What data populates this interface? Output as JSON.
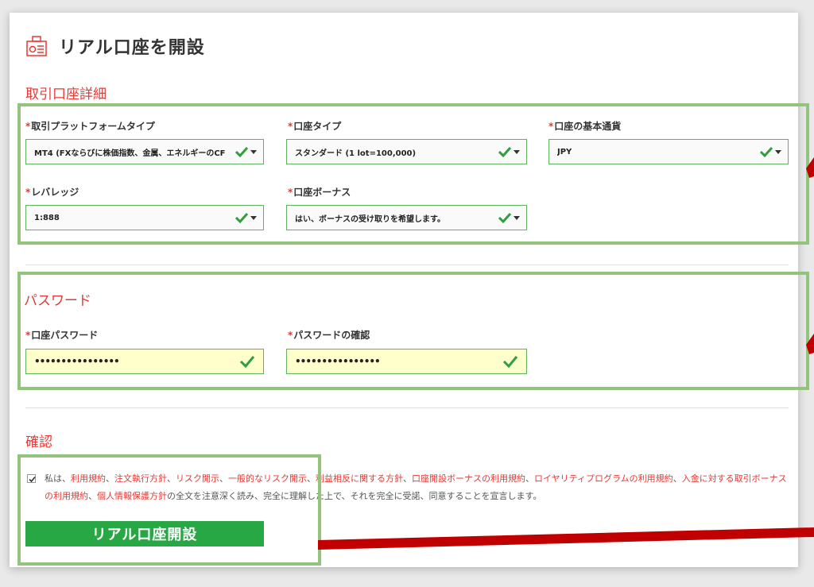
{
  "page": {
    "title": "リアル口座を開設"
  },
  "account_details": {
    "section_title": "取引口座詳細",
    "platform": {
      "required": "*",
      "label": "取引プラットフォームタイプ",
      "value": "MT4 (FXならびに株価指数、金属、エネルギーのCF"
    },
    "account_type": {
      "required": "*",
      "label": "口座タイプ",
      "value": "スタンダード (1 lot=100,000)"
    },
    "base_currency": {
      "required": "*",
      "label": "口座の基本通貨",
      "value": "JPY"
    },
    "leverage": {
      "required": "*",
      "label": "レバレッジ",
      "value": "1:888"
    },
    "bonus": {
      "required": "*",
      "label": "口座ボーナス",
      "value": "はい、ボーナスの受け取りを希望します。"
    }
  },
  "password": {
    "section_title": "パスワード",
    "account_password": {
      "required": "*",
      "label": "口座パスワード",
      "value": "••••••••••••••••"
    },
    "confirm_password": {
      "required": "*",
      "label": "パスワードの確認",
      "value": "••••••••••••••••"
    }
  },
  "confirmation": {
    "section_title": "確認",
    "t1": "私は、",
    "l1": "利用規約",
    "s1": "、",
    "l2": "注文執行方針",
    "s2": "、",
    "l3": "リスク開示",
    "s3": "、",
    "l4": "一般的なリスク開示",
    "s4": "、",
    "l5": "利益相反に関する方針",
    "s5": "、",
    "l6": "口座開設ボーナスの利用規約",
    "s6": "、",
    "l7": "ロイヤリティプログラムの利用規約",
    "s7": "、",
    "l8": "入金に対する取引ボーナスの利用規約",
    "s8": "、",
    "l9": "個人情報保護方針",
    "t2": "の全文を注意深く読み、完全に理解した上で、それを完全に受諾、同意することを宣言します。",
    "submit_label": "リアル口座開設"
  },
  "colors": {
    "accent_red": "#e53935",
    "green_button": "#27a844",
    "highlight_green": "#93c47d",
    "annotation_red": "#c00000"
  }
}
